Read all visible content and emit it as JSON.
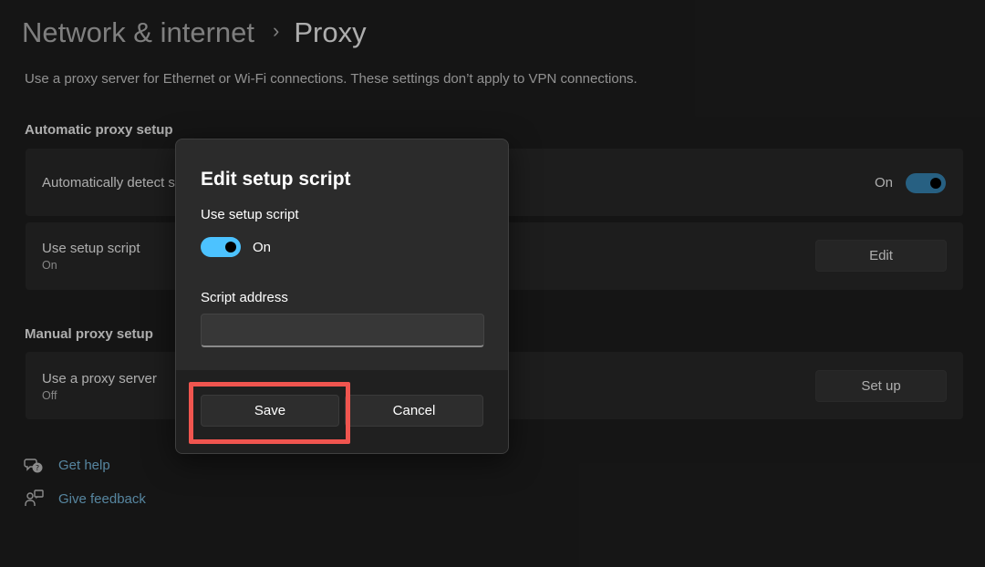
{
  "breadcrumb": {
    "parent": "Network & internet",
    "separator": "›",
    "current": "Proxy"
  },
  "description": "Use a proxy server for Ethernet or Wi-Fi connections. These settings don’t apply to VPN connections.",
  "automatic": {
    "title": "Automatic proxy setup",
    "detect": {
      "label": "Automatically detect s",
      "state": "On"
    },
    "script": {
      "label": "Use setup script",
      "sub": "On",
      "button": "Edit"
    }
  },
  "manual": {
    "title": "Manual proxy setup",
    "proxy": {
      "label": "Use a proxy server",
      "sub": "Off",
      "button": "Set up"
    }
  },
  "links": {
    "help": "Get help",
    "feedback": "Give feedback"
  },
  "dialog": {
    "title": "Edit setup script",
    "toggle_label": "Use setup script",
    "toggle_state": "On",
    "address_label": "Script address",
    "address_value": "",
    "save": "Save",
    "cancel": "Cancel"
  },
  "colors": {
    "accent": "#4cc2ff",
    "highlight": "#f0554f",
    "link": "#7fc4ea"
  },
  "icons": {
    "help": "help-chat-icon",
    "feedback": "feedback-icon",
    "chevron": "chevron-right-icon"
  }
}
